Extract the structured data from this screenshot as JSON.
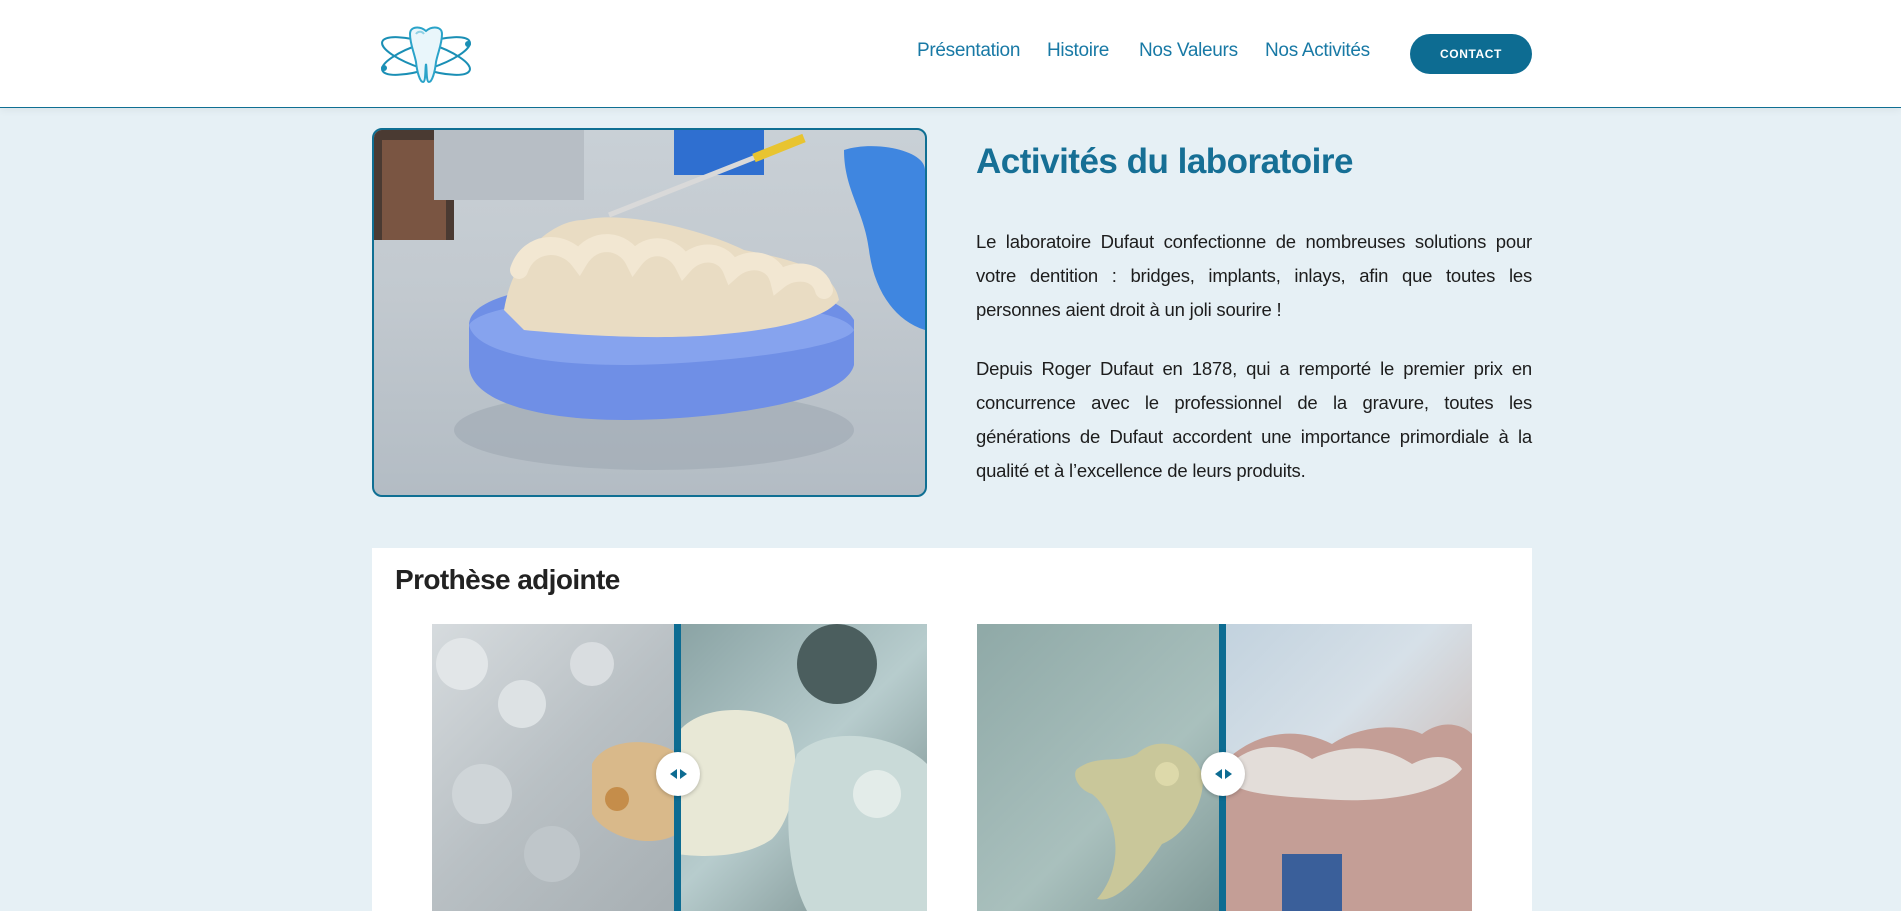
{
  "header": {
    "logo_icon": "tooth-atom-logo",
    "nav": [
      {
        "label": "Présentation"
      },
      {
        "label": "Histoire"
      },
      {
        "label": "Nos Valeurs"
      },
      {
        "label": "Nos Activités"
      }
    ],
    "contact_label": "CONTACT"
  },
  "hero": {
    "image_icon": "dental-model-photo",
    "title": "Activités du laboratoire",
    "paragraph1": "Le laboratoire Dufaut confectionne de nombreuses solutions pour votre dentition : bridges, implants, inlays, afin que toutes les personnes aient droit à un joli sourire !",
    "paragraph2": "Depuis Roger Dufaut en 1878, qui a remporté le premier prix en concurrence avec le professionnel de la gravure, toutes les générations de Dufaut accordent une importance primordiale à la qualité et à l’excellence de leurs produits."
  },
  "section": {
    "title": "Prothèse adjointe",
    "comparisons": [
      {
        "name": "before-after-slider-1"
      },
      {
        "name": "before-after-slider-2"
      }
    ]
  },
  "colors": {
    "accent": "#0d6c92",
    "link": "#1879a5",
    "background": "#e6f0f5"
  }
}
